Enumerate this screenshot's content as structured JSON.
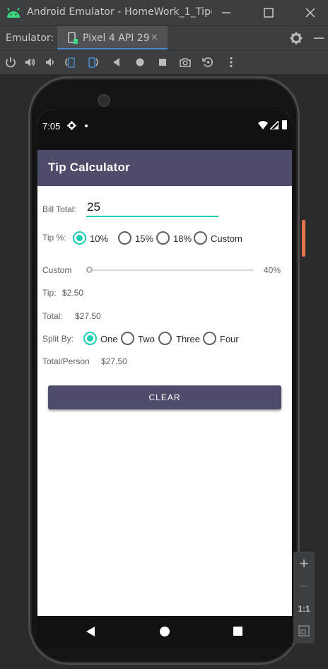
{
  "window": {
    "title": "Android Emulator - HomeWork_1_Tip(",
    "minimize_glyph": "—",
    "maximize_glyph": "☐",
    "close_glyph": "✕"
  },
  "emulator_bar": {
    "label": "Emulator:",
    "active_tab": "Pixel 4 API 29",
    "tab_close_glyph": "✕"
  },
  "toolbar": {
    "icons": [
      "power-icon",
      "volume-up-icon",
      "volume-down-icon",
      "rotate-left-icon",
      "rotate-right-icon",
      "back-icon",
      "home-icon",
      "overview-icon",
      "camera-icon",
      "snapshot-icon",
      "more-icon"
    ]
  },
  "status_bar": {
    "time": "7:05"
  },
  "app": {
    "title": "Tip Calculator",
    "bill_label": "Bill Total:",
    "bill_value": "25",
    "tip_label": "Tip %:",
    "tip_options": [
      "10%",
      "15%",
      "18%",
      "Custom"
    ],
    "tip_selected": "10%",
    "custom_label": "Custom",
    "custom_percent": "40%",
    "custom_slider_fraction": 0,
    "tip_amount_label": "Tip:",
    "tip_amount_value": "$2.50",
    "total_label": "Total:",
    "total_value": "$27.50",
    "split_label": "Split By:",
    "split_options": [
      "One",
      "Two",
      "Three",
      "Four"
    ],
    "split_selected": "One",
    "per_person_label": "Total/Person",
    "per_person_value": "$27.50",
    "clear_button": "CLEAR"
  },
  "zoom_controls": {
    "zoom_in": "+",
    "zoom_out": "−",
    "actual_size": "1:1"
  },
  "colors": {
    "accent": "#1ccfb4",
    "primary": "#4d4c6a",
    "slider_marker": "#e8734a"
  }
}
